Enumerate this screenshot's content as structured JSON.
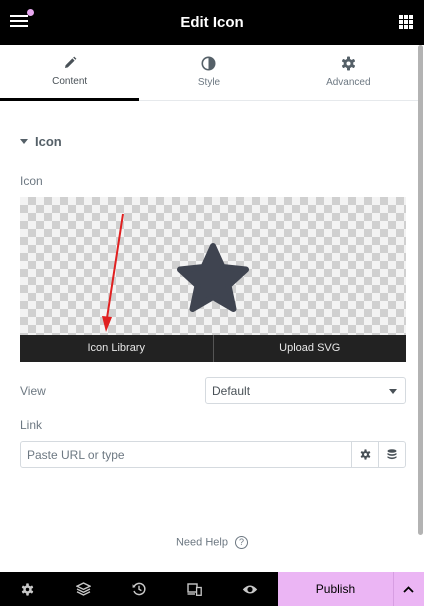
{
  "header": {
    "title": "Edit Icon",
    "menu_icon": "hamburger-icon",
    "apps_icon": "grid-icon",
    "notification_dot_color": "#e8a8f0"
  },
  "tabs": [
    {
      "label": "Content",
      "icon": "pencil-icon",
      "active": true
    },
    {
      "label": "Style",
      "icon": "half-circle-icon",
      "active": false
    },
    {
      "label": "Advanced",
      "icon": "gear-icon",
      "active": false
    }
  ],
  "section": {
    "title": "Icon"
  },
  "icon_control": {
    "label": "Icon",
    "preview_icon": "star-icon",
    "library_button": "Icon Library",
    "upload_button": "Upload SVG"
  },
  "view": {
    "label": "View",
    "value": "Default"
  },
  "link": {
    "label": "Link",
    "placeholder": "Paste URL or type"
  },
  "help": {
    "label": "Need Help",
    "icon": "question-circle-icon"
  },
  "footer": {
    "icons": [
      "settings-icon",
      "layers-icon",
      "history-icon",
      "responsive-icon",
      "preview-eye-icon"
    ],
    "publish_label": "Publish",
    "accent": "#ebb5f4"
  },
  "annotation": {
    "color": "#e02020"
  }
}
